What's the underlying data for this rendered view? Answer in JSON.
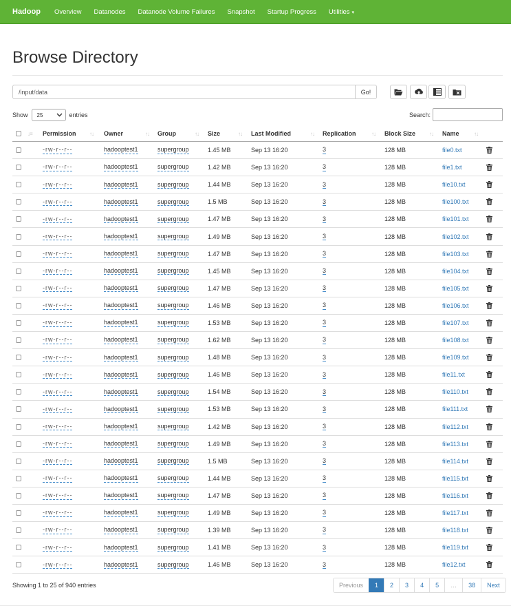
{
  "navbar": {
    "brand": "Hadoop",
    "items": [
      "Overview",
      "Datanodes",
      "Datanode Volume Failures",
      "Snapshot",
      "Startup Progress",
      "Utilities"
    ],
    "bg_color": "#5fb336"
  },
  "page_title": "Browse Directory",
  "path_bar": {
    "value": "/input/data",
    "go_label": "Go!"
  },
  "toolbar": {
    "icons": [
      "folder-open-icon",
      "cloud-upload-icon",
      "list-columns-icon",
      "folder-cut-icon"
    ]
  },
  "length_control": {
    "show_label": "Show",
    "selected": "25",
    "entries_label": "entries"
  },
  "search": {
    "label": "Search:",
    "value": ""
  },
  "table": {
    "columns": [
      "Permission",
      "Owner",
      "Group",
      "Size",
      "Last Modified",
      "Replication",
      "Block Size",
      "Name"
    ],
    "rows": [
      {
        "permission": "-rw-r--r--",
        "owner": "hadooptest1",
        "group": "supergroup",
        "size": "1.45 MB",
        "modified": "Sep 13 16:20",
        "replication": "3",
        "block_size": "128 MB",
        "name": "file0.txt"
      },
      {
        "permission": "-rw-r--r--",
        "owner": "hadooptest1",
        "group": "supergroup",
        "size": "1.42 MB",
        "modified": "Sep 13 16:20",
        "replication": "3",
        "block_size": "128 MB",
        "name": "file1.txt"
      },
      {
        "permission": "-rw-r--r--",
        "owner": "hadooptest1",
        "group": "supergroup",
        "size": "1.44 MB",
        "modified": "Sep 13 16:20",
        "replication": "3",
        "block_size": "128 MB",
        "name": "file10.txt"
      },
      {
        "permission": "-rw-r--r--",
        "owner": "hadooptest1",
        "group": "supergroup",
        "size": "1.5 MB",
        "modified": "Sep 13 16:20",
        "replication": "3",
        "block_size": "128 MB",
        "name": "file100.txt"
      },
      {
        "permission": "-rw-r--r--",
        "owner": "hadooptest1",
        "group": "supergroup",
        "size": "1.47 MB",
        "modified": "Sep 13 16:20",
        "replication": "3",
        "block_size": "128 MB",
        "name": "file101.txt"
      },
      {
        "permission": "-rw-r--r--",
        "owner": "hadooptest1",
        "group": "supergroup",
        "size": "1.49 MB",
        "modified": "Sep 13 16:20",
        "replication": "3",
        "block_size": "128 MB",
        "name": "file102.txt"
      },
      {
        "permission": "-rw-r--r--",
        "owner": "hadooptest1",
        "group": "supergroup",
        "size": "1.47 MB",
        "modified": "Sep 13 16:20",
        "replication": "3",
        "block_size": "128 MB",
        "name": "file103.txt"
      },
      {
        "permission": "-rw-r--r--",
        "owner": "hadooptest1",
        "group": "supergroup",
        "size": "1.45 MB",
        "modified": "Sep 13 16:20",
        "replication": "3",
        "block_size": "128 MB",
        "name": "file104.txt"
      },
      {
        "permission": "-rw-r--r--",
        "owner": "hadooptest1",
        "group": "supergroup",
        "size": "1.47 MB",
        "modified": "Sep 13 16:20",
        "replication": "3",
        "block_size": "128 MB",
        "name": "file105.txt"
      },
      {
        "permission": "-rw-r--r--",
        "owner": "hadooptest1",
        "group": "supergroup",
        "size": "1.46 MB",
        "modified": "Sep 13 16:20",
        "replication": "3",
        "block_size": "128 MB",
        "name": "file106.txt"
      },
      {
        "permission": "-rw-r--r--",
        "owner": "hadooptest1",
        "group": "supergroup",
        "size": "1.53 MB",
        "modified": "Sep 13 16:20",
        "replication": "3",
        "block_size": "128 MB",
        "name": "file107.txt"
      },
      {
        "permission": "-rw-r--r--",
        "owner": "hadooptest1",
        "group": "supergroup",
        "size": "1.62 MB",
        "modified": "Sep 13 16:20",
        "replication": "3",
        "block_size": "128 MB",
        "name": "file108.txt"
      },
      {
        "permission": "-rw-r--r--",
        "owner": "hadooptest1",
        "group": "supergroup",
        "size": "1.48 MB",
        "modified": "Sep 13 16:20",
        "replication": "3",
        "block_size": "128 MB",
        "name": "file109.txt"
      },
      {
        "permission": "-rw-r--r--",
        "owner": "hadooptest1",
        "group": "supergroup",
        "size": "1.46 MB",
        "modified": "Sep 13 16:20",
        "replication": "3",
        "block_size": "128 MB",
        "name": "file11.txt"
      },
      {
        "permission": "-rw-r--r--",
        "owner": "hadooptest1",
        "group": "supergroup",
        "size": "1.54 MB",
        "modified": "Sep 13 16:20",
        "replication": "3",
        "block_size": "128 MB",
        "name": "file110.txt"
      },
      {
        "permission": "-rw-r--r--",
        "owner": "hadooptest1",
        "group": "supergroup",
        "size": "1.53 MB",
        "modified": "Sep 13 16:20",
        "replication": "3",
        "block_size": "128 MB",
        "name": "file111.txt"
      },
      {
        "permission": "-rw-r--r--",
        "owner": "hadooptest1",
        "group": "supergroup",
        "size": "1.42 MB",
        "modified": "Sep 13 16:20",
        "replication": "3",
        "block_size": "128 MB",
        "name": "file112.txt"
      },
      {
        "permission": "-rw-r--r--",
        "owner": "hadooptest1",
        "group": "supergroup",
        "size": "1.49 MB",
        "modified": "Sep 13 16:20",
        "replication": "3",
        "block_size": "128 MB",
        "name": "file113.txt"
      },
      {
        "permission": "-rw-r--r--",
        "owner": "hadooptest1",
        "group": "supergroup",
        "size": "1.5 MB",
        "modified": "Sep 13 16:20",
        "replication": "3",
        "block_size": "128 MB",
        "name": "file114.txt"
      },
      {
        "permission": "-rw-r--r--",
        "owner": "hadooptest1",
        "group": "supergroup",
        "size": "1.44 MB",
        "modified": "Sep 13 16:20",
        "replication": "3",
        "block_size": "128 MB",
        "name": "file115.txt"
      },
      {
        "permission": "-rw-r--r--",
        "owner": "hadooptest1",
        "group": "supergroup",
        "size": "1.47 MB",
        "modified": "Sep 13 16:20",
        "replication": "3",
        "block_size": "128 MB",
        "name": "file116.txt"
      },
      {
        "permission": "-rw-r--r--",
        "owner": "hadooptest1",
        "group": "supergroup",
        "size": "1.49 MB",
        "modified": "Sep 13 16:20",
        "replication": "3",
        "block_size": "128 MB",
        "name": "file117.txt"
      },
      {
        "permission": "-rw-r--r--",
        "owner": "hadooptest1",
        "group": "supergroup",
        "size": "1.39 MB",
        "modified": "Sep 13 16:20",
        "replication": "3",
        "block_size": "128 MB",
        "name": "file118.txt"
      },
      {
        "permission": "-rw-r--r--",
        "owner": "hadooptest1",
        "group": "supergroup",
        "size": "1.41 MB",
        "modified": "Sep 13 16:20",
        "replication": "3",
        "block_size": "128 MB",
        "name": "file119.txt"
      },
      {
        "permission": "-rw-r--r--",
        "owner": "hadooptest1",
        "group": "supergroup",
        "size": "1.46 MB",
        "modified": "Sep 13 16:20",
        "replication": "3",
        "block_size": "128 MB",
        "name": "file12.txt"
      }
    ]
  },
  "info_text": "Showing 1 to 25 of 940 entries",
  "pagination": {
    "previous": "Previous",
    "pages": [
      "1",
      "2",
      "3",
      "4",
      "5",
      "…",
      "38"
    ],
    "active": "1",
    "next": "Next"
  },
  "colors": {
    "link": "#337ab7",
    "active_page": "#337ab7",
    "navbar": "#5fb336"
  }
}
